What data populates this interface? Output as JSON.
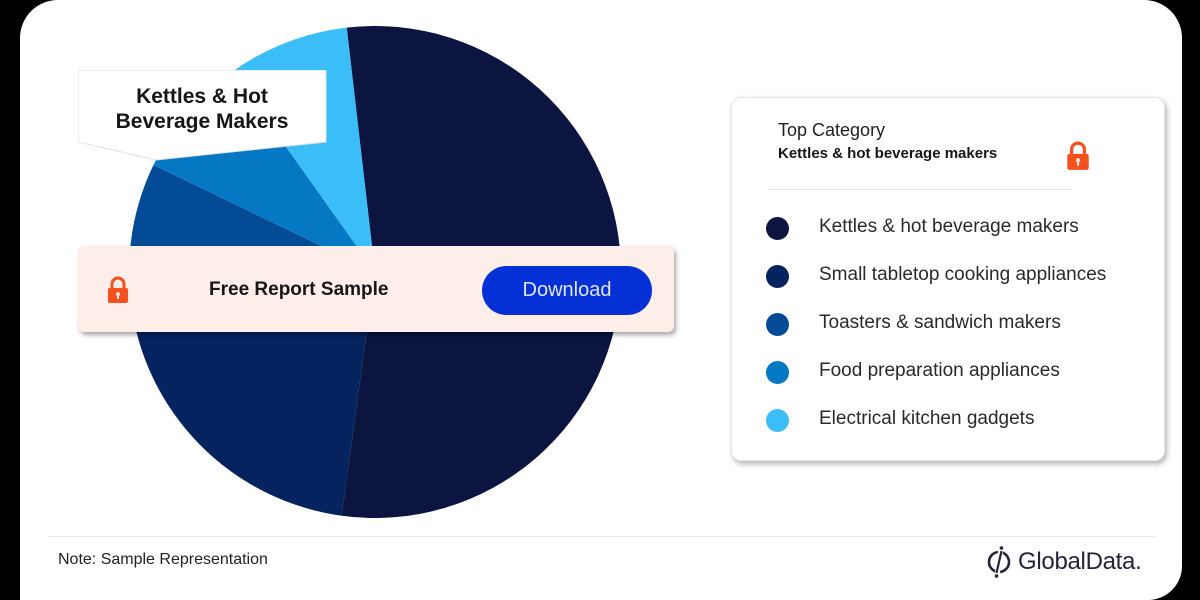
{
  "chart_data": {
    "type": "pie",
    "title": "Kettles & Hot Beverage Makers",
    "start_angle_deg": 353.4,
    "categories": [
      "Kettles & hot beverage makers",
      "Small tabletop cooking appliances",
      "Toasters & sandwich makers",
      "Food preparation appliances",
      "Electrical kitchen gadgets"
    ],
    "values": [
      54,
      21,
      9,
      8,
      8
    ],
    "unit": "percent (estimated, sample representation)",
    "colors": [
      "#0b1540",
      "#04235f",
      "#034a97",
      "#0578c4",
      "#3bbef8"
    ],
    "legend_position": "right"
  },
  "callout": {
    "line1": "Kettles & Hot",
    "line2": "Beverage Makers"
  },
  "banner": {
    "label": "Free Report Sample",
    "button_label": "Download",
    "icon": "lock-icon"
  },
  "legend": {
    "top_category_title": "Top Category",
    "top_category_value": "Kettles & hot beverage makers",
    "icon": "lock-icon",
    "items": [
      {
        "label": "Kettles & hot beverage makers",
        "color": "#0b1540"
      },
      {
        "label": "Small tabletop cooking appliances",
        "color": "#04235f"
      },
      {
        "label": "Toasters & sandwich makers",
        "color": "#034a97"
      },
      {
        "label": "Food preparation appliances",
        "color": "#0578c4"
      },
      {
        "label": "Electrical kitchen gadgets",
        "color": "#3bbef8"
      }
    ]
  },
  "footer": {
    "note": "Note: Sample Representation",
    "brand": "GlobalData."
  },
  "colors": {
    "accent_button": "#0530d6",
    "lock": "#f4511e",
    "banner_bg": "#fdeeea"
  }
}
